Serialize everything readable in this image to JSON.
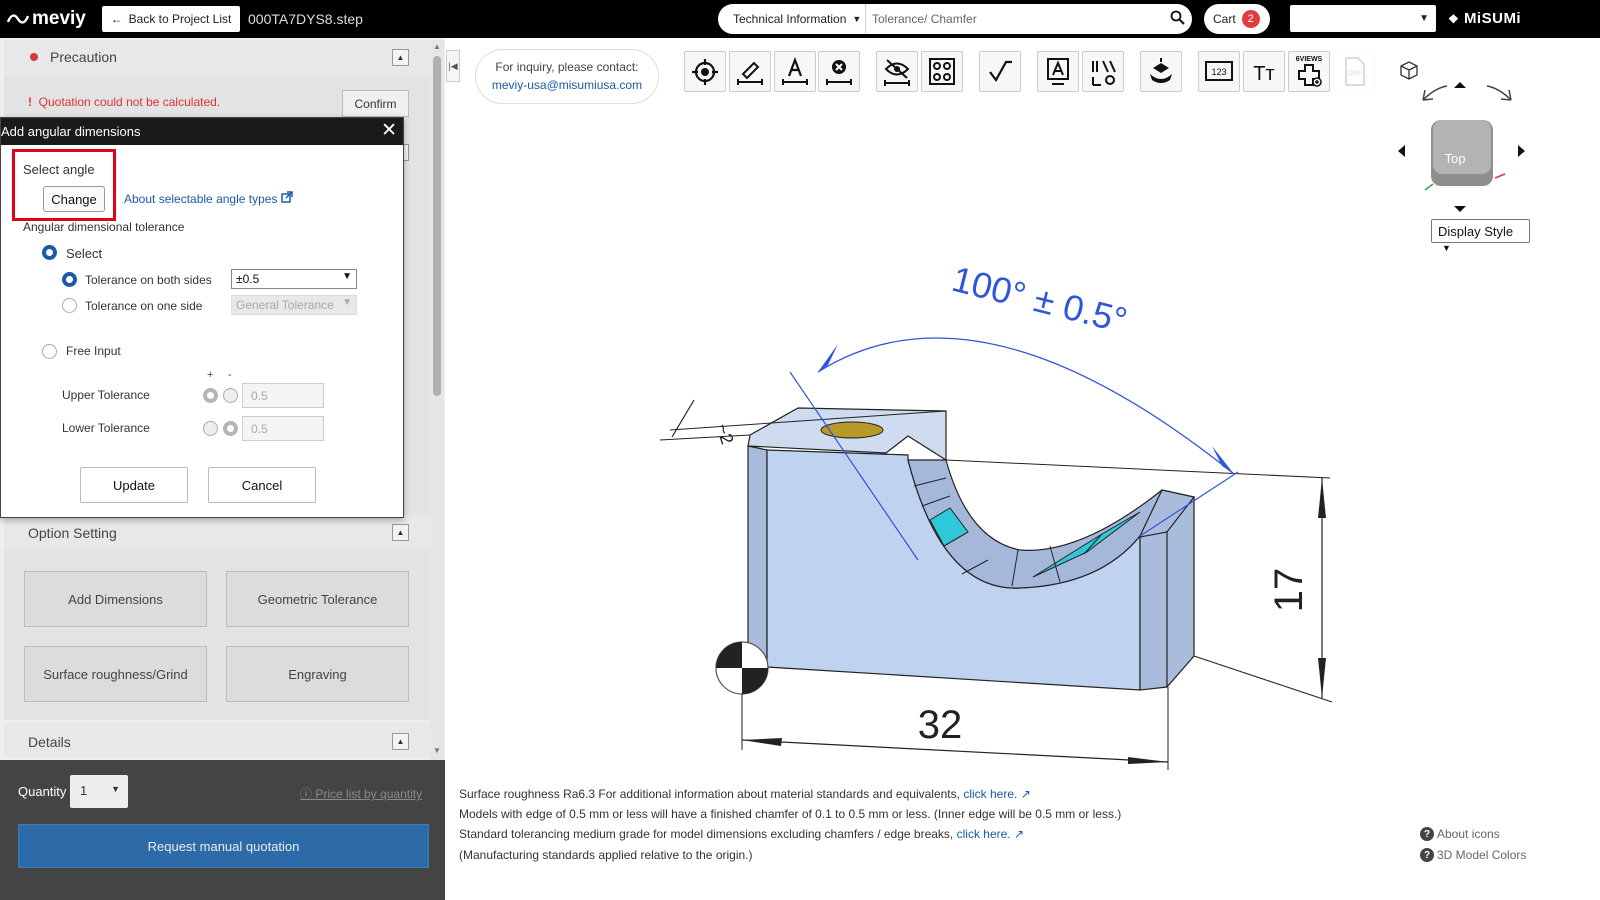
{
  "header": {
    "logo_text": "meviy",
    "back_label": "Back to Project List",
    "file_name": "000TA7DYS8.step",
    "search_category": "Technical Information",
    "search_placeholder": "Tolerance/ Chamfer",
    "cart_label": "Cart",
    "cart_count": "2",
    "language_value": "",
    "brand": "MiSUMi"
  },
  "left_panel": {
    "precaution_title": "Precaution",
    "warning_text": "Quotation could not be calculated.",
    "confirm_label": "Confirm",
    "option_setting_title": "Option Setting",
    "option_buttons": [
      "Add Dimensions",
      "Geometric Tolerance",
      "Surface roughness/Grind",
      "Engraving"
    ],
    "details_title": "Details",
    "quantity_label": "Quantity",
    "quantity_value": "1",
    "price_list_label": "Price list by quantity",
    "request_label": "Request manual quotation"
  },
  "dialog": {
    "title": "Add angular dimensions",
    "select_angle_label": "Select angle",
    "change_label": "Change",
    "about_link": "About selectable angle types",
    "tolerance_heading": "Angular dimensional tolerance",
    "select_label": "Select",
    "both_sides_label": "Tolerance on both sides",
    "both_sides_value": "±0.5",
    "one_side_label": "Tolerance on one side",
    "one_side_value": "General Tolerance",
    "free_input_label": "Free Input",
    "plus_sign": "+",
    "minus_sign": "-",
    "upper_label": "Upper Tolerance",
    "upper_value": "0.5",
    "lower_label": "Lower Tolerance",
    "lower_value": "0.5",
    "update_label": "Update",
    "cancel_label": "Cancel"
  },
  "viewer": {
    "inquiry_line1": "For inquiry, please contact:",
    "inquiry_email": "meviy-usa@misumiusa.com",
    "cube_face": "Top",
    "display_style_label": "Display Style",
    "dims": {
      "angle": "100° ± 0.5°",
      "height": "17",
      "width": "32",
      "small": "~2"
    },
    "info": {
      "line1_a": "Surface roughness Ra6.3    For additional information about material standards and equivalents,",
      "line1_link": "click here.",
      "line2": "Models with edge of 0.5 mm or less will have a finished chamfer of 0.1 to 0.5 mm or less. (Inner edge will be 0.5 mm or less.)",
      "line3_a": "Standard tolerancing medium grade for model dimensions excluding chamfers / edge breaks,",
      "line3_link": "click here.",
      "line4": "(Manufacturing standards applied relative to the origin.)"
    },
    "about_icons": "About icons",
    "model_colors": "3D Model Colors",
    "tool_labels": {
      "six_views": "6VIEWS",
      "counter": "123",
      "text": "Tт",
      "dxf": "DXF"
    }
  },
  "colors": {
    "accent_blue": "#1a5aa8",
    "warning_red": "#d9343a",
    "request_button": "#2c6aa8",
    "dimension_blue": "#2f56d8",
    "model_face": "#bcd0ee",
    "model_cyan": "#2ec8d8"
  }
}
